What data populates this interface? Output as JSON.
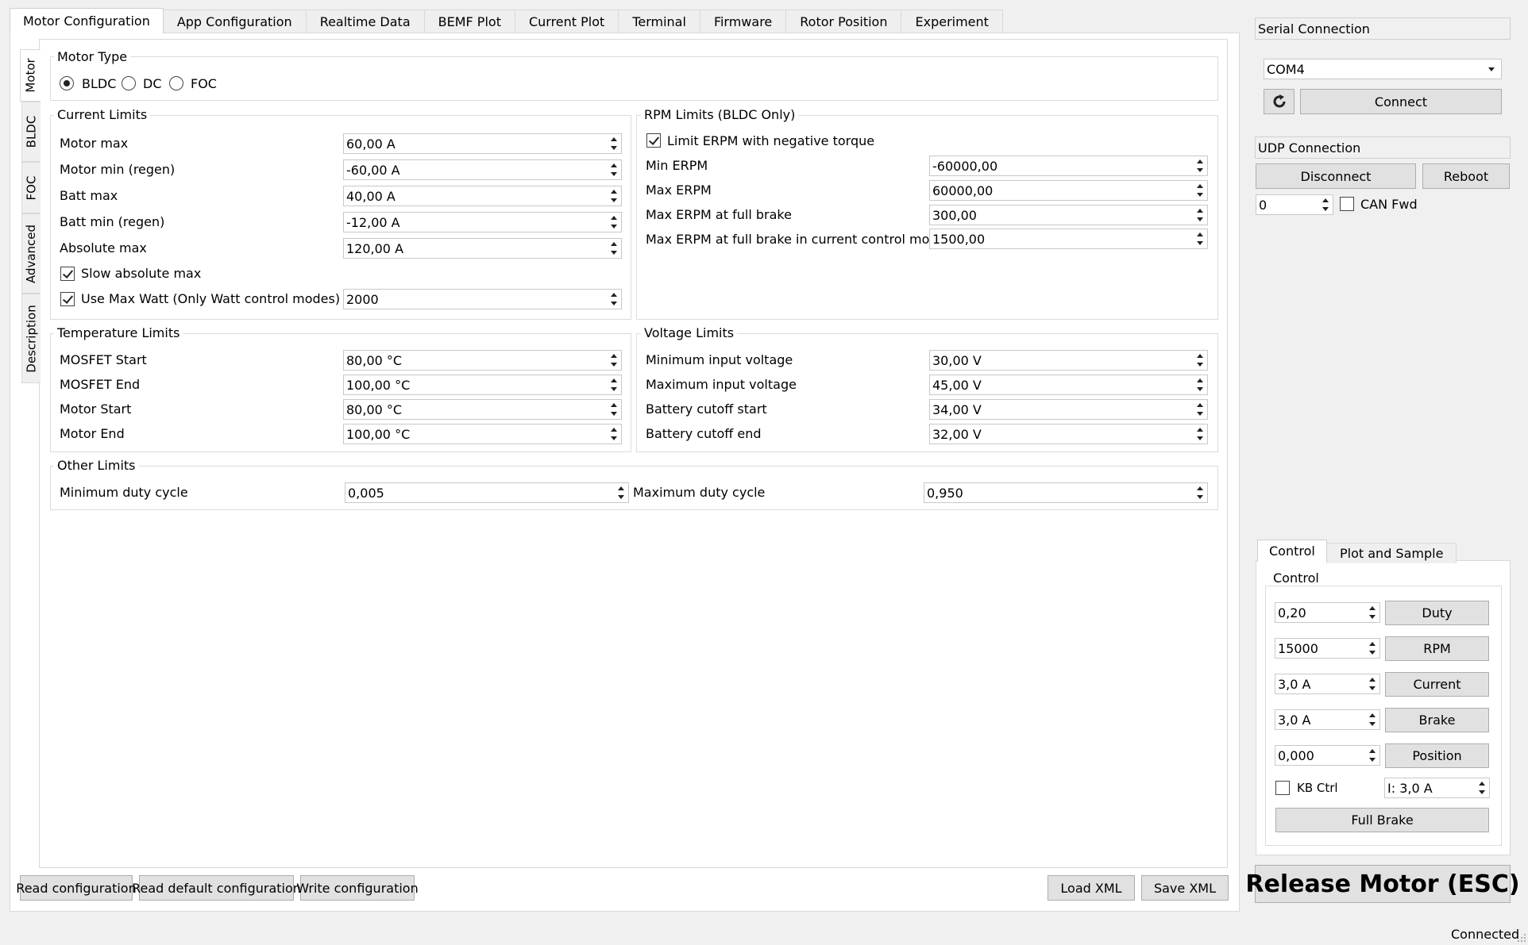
{
  "tabs": [
    "Motor Configuration",
    "App Configuration",
    "Realtime Data",
    "BEMF Plot",
    "Current Plot",
    "Terminal",
    "Firmware",
    "Rotor Position",
    "Experiment"
  ],
  "side_tabs": [
    "Motor",
    "BLDC",
    "FOC",
    "Advanced",
    "Description"
  ],
  "motor_type": {
    "title": "Motor Type",
    "options": [
      "BLDC",
      "DC",
      "FOC"
    ],
    "selected": "BLDC"
  },
  "current_limits": {
    "title": "Current Limits",
    "motor_max": {
      "label": "Motor max",
      "value": "60,00 A"
    },
    "motor_min": {
      "label": "Motor min (regen)",
      "value": "-60,00 A"
    },
    "batt_max": {
      "label": "Batt max",
      "value": "40,00 A"
    },
    "batt_min": {
      "label": "Batt min (regen)",
      "value": "-12,00 A"
    },
    "abs_max": {
      "label": "Absolute max",
      "value": "120,00 A"
    },
    "slow_abs": {
      "label": "Slow absolute max",
      "checked": true
    },
    "max_watt": {
      "label": "Use Max Watt (Only Watt control modes)",
      "checked": true,
      "value": "2000"
    }
  },
  "rpm_limits": {
    "title": "RPM Limits (BLDC Only)",
    "limit_neg": {
      "label": "Limit ERPM with negative torque",
      "checked": true
    },
    "min_erpm": {
      "label": "Min ERPM",
      "value": "-60000,00"
    },
    "max_erpm": {
      "label": "Max ERPM",
      "value": "60000,00"
    },
    "full_brake": {
      "label": "Max ERPM at full brake",
      "value": "300,00"
    },
    "full_brake_cc": {
      "label": "Max ERPM at full brake in current control mode",
      "value": "1500,00"
    }
  },
  "temp_limits": {
    "title": "Temperature Limits",
    "mosfet_start": {
      "label": "MOSFET Start",
      "value": "80,00 °C"
    },
    "mosfet_end": {
      "label": "MOSFET End",
      "value": "100,00 °C"
    },
    "motor_start": {
      "label": "Motor Start",
      "value": "80,00 °C"
    },
    "motor_end": {
      "label": "Motor End",
      "value": "100,00 °C"
    }
  },
  "voltage_limits": {
    "title": "Voltage Limits",
    "min_in": {
      "label": "Minimum input voltage",
      "value": "30,00 V"
    },
    "max_in": {
      "label": "Maximum input voltage",
      "value": "45,00 V"
    },
    "cut_start": {
      "label": "Battery cutoff start",
      "value": "34,00 V"
    },
    "cut_end": {
      "label": "Battery cutoff end",
      "value": "32,00 V"
    }
  },
  "other_limits": {
    "title": "Other Limits",
    "min_duty": {
      "label": "Minimum duty cycle",
      "value": "0,005"
    },
    "max_duty": {
      "label": "Maximum duty cycle",
      "value": "0,950"
    }
  },
  "bottom_buttons": {
    "read": "Read configuration",
    "read_default": "Read default configuration",
    "write": "Write configuration",
    "load_xml": "Load XML",
    "save_xml": "Save XML"
  },
  "serial": {
    "title": "Serial Connection",
    "port": "COM4",
    "connect": "Connect"
  },
  "udp": {
    "title": "UDP Connection",
    "disconnect": "Disconnect",
    "reboot": "Reboot",
    "can_id": "0",
    "can_fwd": "CAN Fwd"
  },
  "control_tabs": [
    "Control",
    "Plot and Sample"
  ],
  "control": {
    "title": "Control",
    "duty": {
      "value": "0,20",
      "button": "Duty"
    },
    "rpm": {
      "value": "15000",
      "button": "RPM"
    },
    "current": {
      "value": "3,0 A",
      "button": "Current"
    },
    "brake": {
      "value": "3,0 A",
      "button": "Brake"
    },
    "position": {
      "value": "0,000",
      "button": "Position"
    },
    "kb_ctrl": "KB Ctrl",
    "kb_current": "I: 3,0 A",
    "full_brake": "Full Brake"
  },
  "release": "Release Motor (ESC)",
  "status": "Connected"
}
